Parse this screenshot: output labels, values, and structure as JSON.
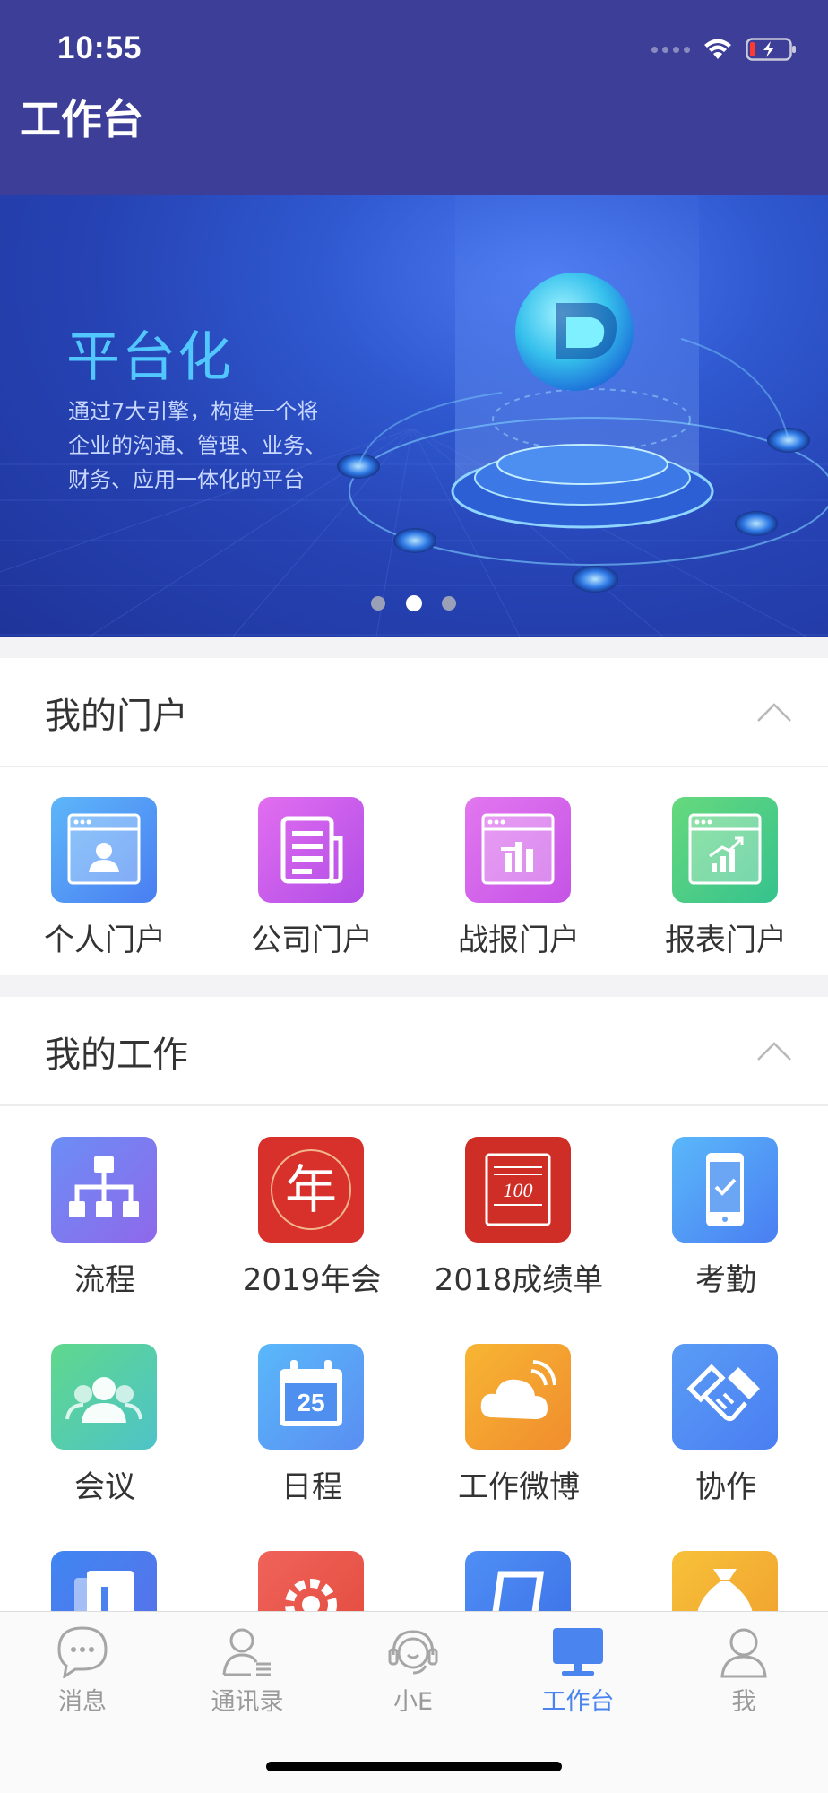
{
  "status": {
    "time": "10:55"
  },
  "header": {
    "title": "工作台"
  },
  "banner": {
    "title": "平台化",
    "desc_lines": [
      "通过7大引擎，构建一个将",
      "企业的沟通、管理、业务、",
      "财务、应用一体化的平台"
    ],
    "active_page": 2,
    "page_count": 3
  },
  "portal": {
    "title": "我的门户",
    "items": [
      {
        "label": "个人门户",
        "icon": "person-portal-icon"
      },
      {
        "label": "公司门户",
        "icon": "newspaper-icon"
      },
      {
        "label": "战报门户",
        "icon": "report-window-icon"
      },
      {
        "label": "报表门户",
        "icon": "chart-window-icon"
      }
    ]
  },
  "work": {
    "title": "我的工作",
    "items": [
      {
        "label": "流程",
        "icon": "org-chart-icon"
      },
      {
        "label": "2019年会",
        "icon": "nian-icon"
      },
      {
        "label": "2018成绩单",
        "icon": "score-100-icon"
      },
      {
        "label": "考勤",
        "icon": "phone-check-icon"
      },
      {
        "label": "会议",
        "icon": "people-icon"
      },
      {
        "label": "日程",
        "icon": "calendar-icon"
      },
      {
        "label": "工作微博",
        "icon": "cloud-icon"
      },
      {
        "label": "协作",
        "icon": "handshake-icon"
      }
    ],
    "calendar_day": "25",
    "score_text": "100",
    "nian_text": "年"
  },
  "nav": {
    "items": [
      {
        "label": "消息",
        "icon": "chat-bubble-icon"
      },
      {
        "label": "通讯录",
        "icon": "contacts-icon"
      },
      {
        "label": "小E",
        "icon": "headset-icon"
      },
      {
        "label": "工作台",
        "icon": "monitor-icon"
      },
      {
        "label": "我",
        "icon": "user-icon"
      }
    ],
    "active": "工作台"
  },
  "colors": {
    "header_bg": "#3d3e97",
    "accent": "#4a84ef",
    "banner_title": "#52c7ff"
  }
}
